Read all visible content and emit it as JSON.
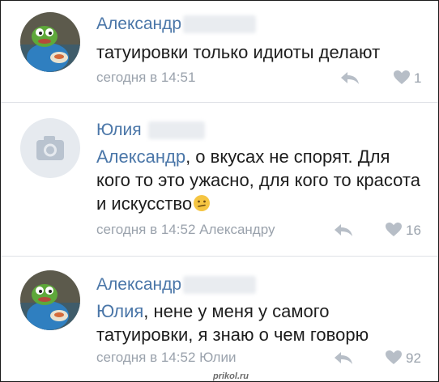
{
  "comments": [
    {
      "author": "Александр",
      "text": "татуировки только идиоты делают",
      "meta": "сегодня в 14:51",
      "likes": "1"
    },
    {
      "author": "Юлия",
      "mention": "Александр",
      "text_after_mention": ", о вкусах не спорят. Для кого то это ужасно,  для кого то красота и искусство",
      "meta": "сегодня в 14:52 Александру",
      "likes": "16"
    },
    {
      "author": "Александр",
      "mention": "Юлия",
      "text_after_mention": ", нене у меня у самого татуировки, я знаю о чем говорю",
      "meta": "сегодня в 14:52 Юлии",
      "likes": "92"
    }
  ],
  "watermark": "prikol.ru",
  "colors": {
    "link": "#4a76a8",
    "muted": "#9aa2ac",
    "text": "#1d1d1d",
    "separator": "#dfe2e7"
  },
  "icons": [
    "avatar-frog-icon",
    "camera-icon",
    "reply-arrow-icon",
    "heart-icon",
    "confused-emoji-icon"
  ]
}
